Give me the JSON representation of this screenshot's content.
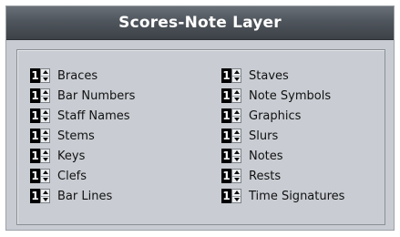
{
  "window": {
    "title": "Scores-Note Layer"
  },
  "left_column": [
    {
      "value": "1",
      "label": "Braces"
    },
    {
      "value": "1",
      "label": "Bar Numbers"
    },
    {
      "value": "1",
      "label": "Staff Names"
    },
    {
      "value": "1",
      "label": "Stems"
    },
    {
      "value": "1",
      "label": "Keys"
    },
    {
      "value": "1",
      "label": "Clefs"
    },
    {
      "value": "1",
      "label": "Bar Lines"
    }
  ],
  "right_column": [
    {
      "value": "1",
      "label": "Staves"
    },
    {
      "value": "1",
      "label": "Note Symbols"
    },
    {
      "value": "1",
      "label": "Graphics"
    },
    {
      "value": "1",
      "label": "Slurs"
    },
    {
      "value": "1",
      "label": "Notes"
    },
    {
      "value": "1",
      "label": "Rests"
    },
    {
      "value": "1",
      "label": "Time Signatures"
    }
  ]
}
